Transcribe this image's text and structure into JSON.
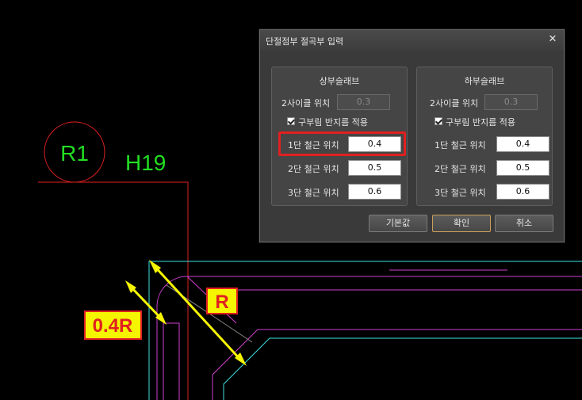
{
  "dialog": {
    "title": "단절점부 절곡부 입력",
    "upper_group": {
      "title": "상부슬래브",
      "spacing_label": "2사이클 위치",
      "spacing_value": "0.3",
      "checkbox_label": "구부림 반지름 적용",
      "checkbox_checked": true,
      "rows": [
        {
          "label": "1단 철근 위치",
          "value": "0.4"
        },
        {
          "label": "2단 철근 위치",
          "value": "0.5"
        },
        {
          "label": "3단 철근 위치",
          "value": "0.6"
        }
      ]
    },
    "lower_group": {
      "title": "하부슬래브",
      "spacing_label": "2사이클 위치",
      "spacing_value": "0.3",
      "checkbox_label": "구부림 반지름 적용",
      "checkbox_checked": true,
      "rows": [
        {
          "label": "1단 철근 위치",
          "value": "0.4"
        },
        {
          "label": "2단 철근 위치",
          "value": "0.5"
        },
        {
          "label": "3단 철근 위치",
          "value": "0.6"
        }
      ]
    },
    "buttons": {
      "default_label": "기본값",
      "ok_label": "확인",
      "cancel_label": "취소"
    }
  },
  "drawing": {
    "circle_label": "R1",
    "tag_label": "H19",
    "dim_label_small": "0.4R",
    "dim_label_large": "R"
  },
  "colors": {
    "cad_red": "#e02020",
    "cad_green": "#22dd22",
    "cad_cyan": "#3fe0e0",
    "cad_magenta": "#d040d0",
    "cad_yellow": "#f5f500",
    "highlight_red": "#e02020"
  }
}
